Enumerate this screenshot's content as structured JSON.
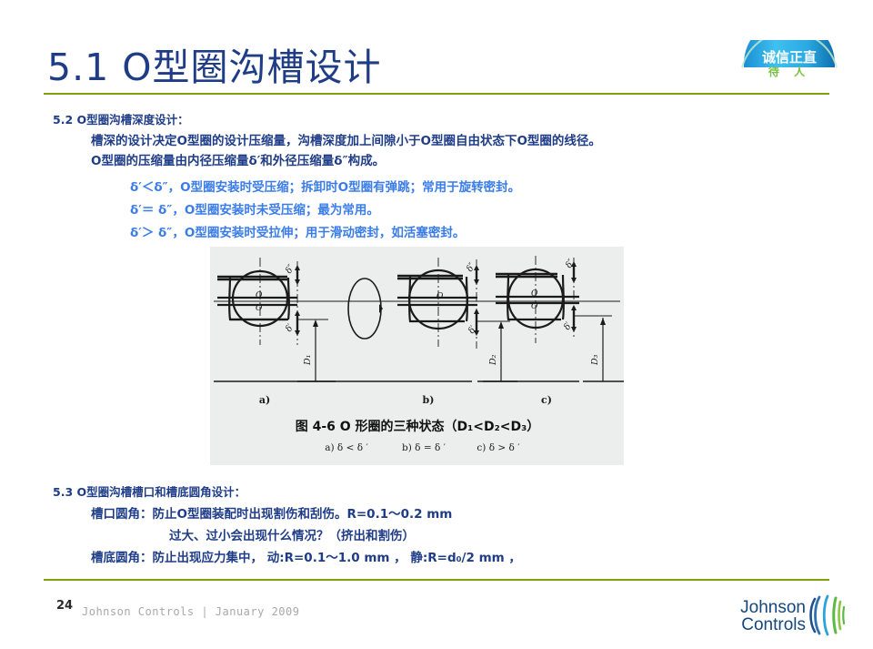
{
  "slide": {
    "title": "5.1  O型圈沟槽设计",
    "rule_color": "#7ca30c",
    "title_color": "#1f3d87"
  },
  "values_logo": {
    "name": "integrity-values-logo",
    "arc_text": "诚信正直",
    "sub_text": "待    人",
    "arc_color": "#2bb3e6",
    "sub_color": "#7ac143"
  },
  "content": {
    "section_52": {
      "heading": "5.2 O型圈沟槽深度设计：",
      "lines": [
        "槽深的设计决定O型圈的设计压缩量，沟槽深度加上间隙小于O型圈自由状态下O型圈的线径。",
        "O型圈的压缩量由内径压缩量δ′和外径压缩量δ″构成。"
      ],
      "bullets": [
        "δ′＜δ″，O型圈安装时受压缩；拆卸时O型圈有弹跳；常用于旋转密封。",
        "δ′＝ δ″，O型圈安装时未受压缩；最为常用。",
        "δ′＞ δ″，O型圈安装时受拉伸；用于滑动密封，如活塞密封。"
      ],
      "bullet_color": "#3a7ce8"
    },
    "section_53": {
      "heading": "5.3 O型圈沟槽槽口和槽底圆角设计：",
      "lines": [
        "槽口圆角：防止O型圈装配时出现割伤和刮伤。R=0.1～0.2 mm",
        "过大、过小会出现什么情况？（挤出和割伤）",
        "槽底圆角：防止出现应力集中， 动:R=0.1～1.0 mm ， 静:R=d₀/2 mm ，"
      ]
    }
  },
  "figure": {
    "name": "o-ring-three-states-figure",
    "background": "#eceeed",
    "caption_main": "图 4-6   O 形圈的三种状态（D₁<D₂<D₃）",
    "caption_sub_items": [
      "a) δ < δ ′",
      "b) δ = δ ′",
      "c) δ > δ ′"
    ],
    "panels": [
      {
        "label": "a)",
        "center_label": "O",
        "secondary_label": "O′",
        "delta_top": "δ″",
        "delta_bottom": "δ′",
        "diameter_label": "D₁"
      },
      {
        "label": "b)",
        "center_label": "O",
        "secondary_label": "",
        "delta_top": "δ″",
        "delta_bottom": "δ′",
        "diameter_label": "D₂"
      },
      {
        "label": "c)",
        "center_label": "O",
        "secondary_label": "O′",
        "delta_top": "δ″",
        "delta_bottom": "δ′",
        "diameter_label": "D₃"
      }
    ]
  },
  "footer": {
    "page_number": "24",
    "text": "Johnson Controls | January 2009",
    "logo": {
      "name": "johnson-controls-logo",
      "line1": "Johnson",
      "line2": "Controls",
      "text_color": "#14477d",
      "mark_blue": "#1d4f91",
      "mark_green": "#5bb946",
      "mark_cyan": "#29a3dc"
    }
  }
}
